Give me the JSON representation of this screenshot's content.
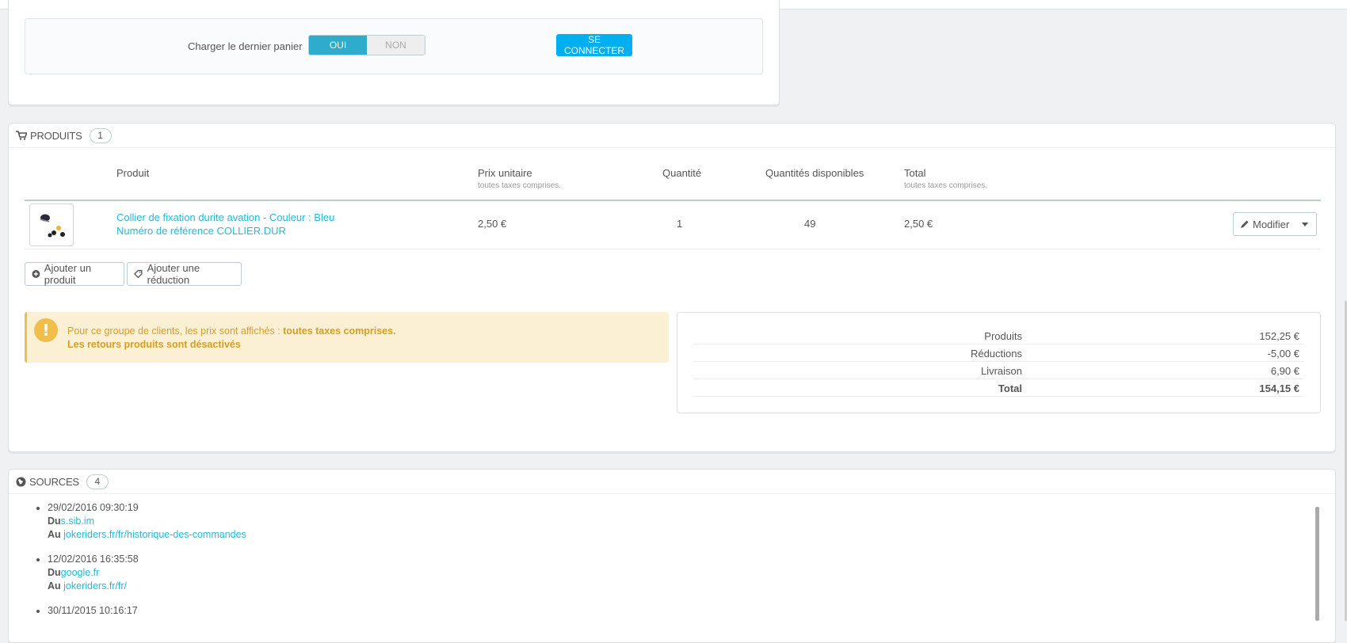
{
  "cart": {
    "load_label": "Charger le dernier panier",
    "toggle_yes": "OUI",
    "toggle_no": "NON",
    "connect_label": "SE CONNECTER"
  },
  "products": {
    "title": "PRODUITS",
    "count": "1",
    "columns": {
      "product": "Produit",
      "unit_price": "Prix unitaire",
      "unit_price_sub": "toutes taxes comprises.",
      "quantity": "Quantité",
      "available": "Quantités disponibles",
      "total": "Total",
      "total_sub": "toutes taxes comprises."
    },
    "rows": [
      {
        "name": "Collier de fixation durite avation - Couleur : Bleu",
        "reference": "Numéro de référence COLLIER.DUR",
        "unit_price": "2,50 €",
        "quantity": "1",
        "available": "49",
        "total": "2,50 €",
        "action": "Modifier"
      }
    ],
    "add_product": "Ajouter un produit",
    "add_discount": "Ajouter une réduction"
  },
  "alert": {
    "line1_prefix": "Pour ce groupe de clients, les prix sont affichés : ",
    "line1_bold": "toutes taxes comprises.",
    "line2": "Les retours produits sont désactivés"
  },
  "totals": {
    "products_label": "Produits",
    "products_value": "152,25 €",
    "discounts_label": "Réductions",
    "discounts_value": "-5,00 €",
    "shipping_label": "Livraison",
    "shipping_value": "6,90 €",
    "total_label": "Total",
    "total_value": "154,15 €"
  },
  "sources": {
    "title": "SOURCES",
    "count": "4",
    "from_label": "Du",
    "to_label": "Au",
    "items": [
      {
        "date": "29/02/2016 09:30:19",
        "from": "s.sib.im",
        "to": "jokeriders.fr/fr/historique-des-commandes"
      },
      {
        "date": "12/02/2016 16:35:58",
        "from": "google.fr",
        "to": "jokeriders.fr/fr/"
      },
      {
        "date": "30/11/2015 10:16:17"
      }
    ]
  }
}
